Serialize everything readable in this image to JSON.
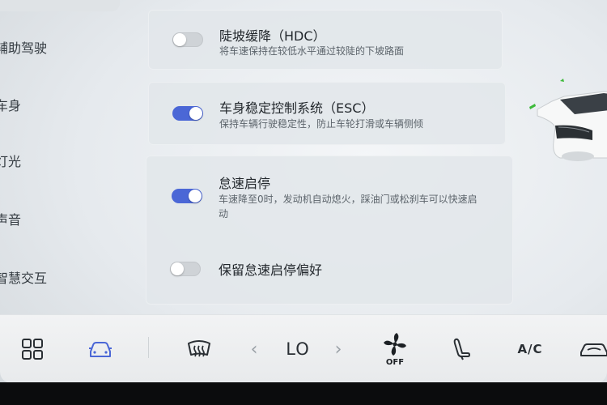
{
  "sidebar": {
    "items": [
      {
        "label": "辅助驾驶"
      },
      {
        "label": "车身"
      },
      {
        "label": "灯光"
      },
      {
        "label": "声音"
      },
      {
        "label": "智慧交互"
      }
    ]
  },
  "settings": {
    "hdc": {
      "title": "陡坡缓降（HDC）",
      "desc": "将车速保持在较低水平通过较陡的下坡路面",
      "on": false
    },
    "esc": {
      "title": "车身稳定控制系统（ESC）",
      "desc": "保持车辆行驶稳定性，防止车轮打滑或车辆侧倾",
      "on": true
    },
    "start_stop": {
      "title": "怠速启停",
      "desc": "车速降至0时，发动机自动熄火，踩油门或松刹车可以快速启动",
      "on": true
    },
    "keep_pref": {
      "title": "保留怠速启停偏好",
      "on": false
    }
  },
  "dock": {
    "temp_label": "LO",
    "fan_label": "OFF",
    "ac_label": "A/C",
    "icons": [
      "grid-icon",
      "car-icon",
      "rear-defrost-icon",
      "chevron-left-icon",
      "chevron-right-icon",
      "fan-icon",
      "seat-icon",
      "ac-icon",
      "air-recirculation-icon"
    ],
    "accent": "#4b67d6"
  }
}
